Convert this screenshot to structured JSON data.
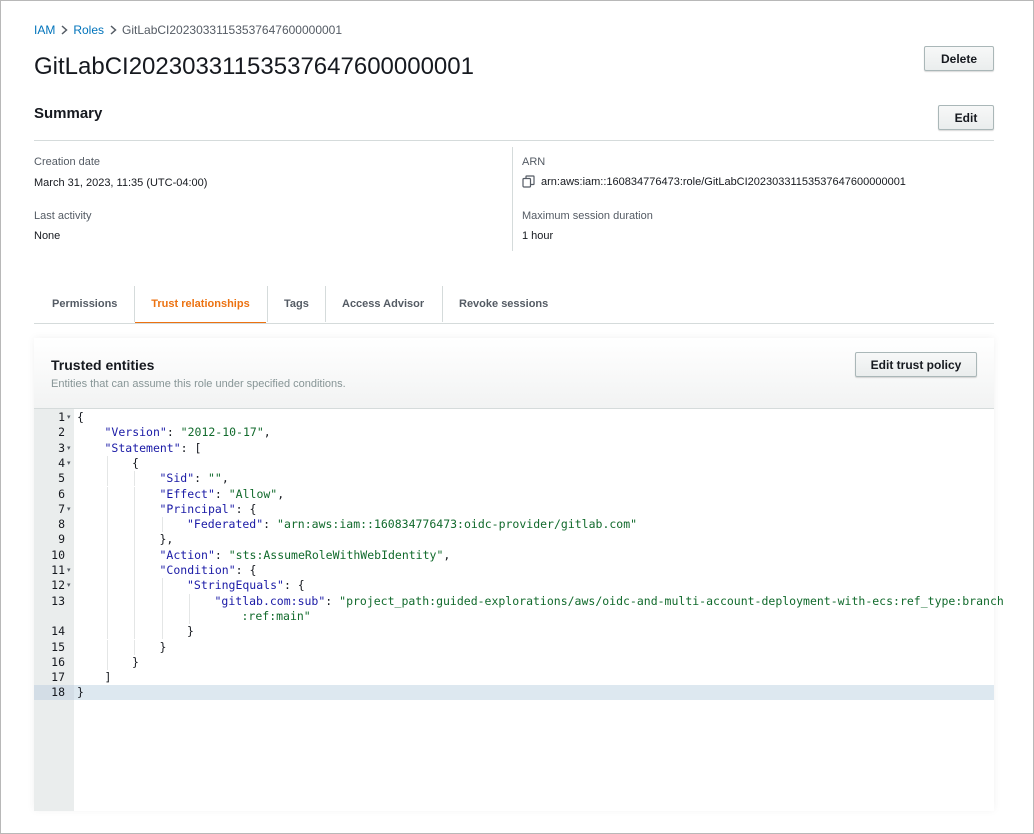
{
  "breadcrumb": {
    "items": [
      "IAM",
      "Roles",
      "GitLabCI20230331153537647600000001"
    ]
  },
  "page": {
    "title": "GitLabCI20230331153537647600000001",
    "delete_label": "Delete"
  },
  "summary": {
    "title": "Summary",
    "edit_label": "Edit",
    "creation_date_label": "Creation date",
    "creation_date_value": "March 31, 2023, 11:35 (UTC-04:00)",
    "last_activity_label": "Last activity",
    "last_activity_value": "None",
    "arn_label": "ARN",
    "arn_value": "arn:aws:iam::160834776473:role/GitLabCI20230331153537647600000001",
    "max_session_label": "Maximum session duration",
    "max_session_value": "1 hour"
  },
  "tabs": [
    {
      "label": "Permissions",
      "active": false
    },
    {
      "label": "Trust relationships",
      "active": true
    },
    {
      "label": "Tags",
      "active": false
    },
    {
      "label": "Access Advisor",
      "active": false
    },
    {
      "label": "Revoke sessions",
      "active": false
    }
  ],
  "trusted_entities": {
    "title": "Trusted entities",
    "description": "Entities that can assume this role under specified conditions.",
    "edit_label": "Edit trust policy"
  },
  "editor": {
    "lines": [
      {
        "n": "1",
        "fold": true,
        "indent": 0,
        "parts": [
          [
            "p",
            "{"
          ]
        ]
      },
      {
        "n": "2",
        "fold": false,
        "indent": 1,
        "parts": [
          [
            "k",
            "\"Version\""
          ],
          [
            "p",
            ": "
          ],
          [
            "s",
            "\"2012-10-17\""
          ],
          [
            "p",
            ","
          ]
        ]
      },
      {
        "n": "3",
        "fold": true,
        "indent": 1,
        "parts": [
          [
            "k",
            "\"Statement\""
          ],
          [
            "p",
            ": ["
          ]
        ]
      },
      {
        "n": "4",
        "fold": true,
        "indent": 2,
        "parts": [
          [
            "p",
            "{"
          ]
        ]
      },
      {
        "n": "5",
        "fold": false,
        "indent": 3,
        "parts": [
          [
            "k",
            "\"Sid\""
          ],
          [
            "p",
            ": "
          ],
          [
            "s",
            "\"\""
          ],
          [
            "p",
            ","
          ]
        ]
      },
      {
        "n": "6",
        "fold": false,
        "indent": 3,
        "parts": [
          [
            "k",
            "\"Effect\""
          ],
          [
            "p",
            ": "
          ],
          [
            "s",
            "\"Allow\""
          ],
          [
            "p",
            ","
          ]
        ]
      },
      {
        "n": "7",
        "fold": true,
        "indent": 3,
        "parts": [
          [
            "k",
            "\"Principal\""
          ],
          [
            "p",
            ": {"
          ]
        ]
      },
      {
        "n": "8",
        "fold": false,
        "indent": 4,
        "parts": [
          [
            "k",
            "\"Federated\""
          ],
          [
            "p",
            ": "
          ],
          [
            "s",
            "\"arn:aws:iam::160834776473:oidc-provider/gitlab.com\""
          ]
        ]
      },
      {
        "n": "9",
        "fold": false,
        "indent": 3,
        "parts": [
          [
            "p",
            "},"
          ]
        ]
      },
      {
        "n": "10",
        "fold": false,
        "indent": 3,
        "parts": [
          [
            "k",
            "\"Action\""
          ],
          [
            "p",
            ": "
          ],
          [
            "s",
            "\"sts:AssumeRoleWithWebIdentity\""
          ],
          [
            "p",
            ","
          ]
        ]
      },
      {
        "n": "11",
        "fold": true,
        "indent": 3,
        "parts": [
          [
            "k",
            "\"Condition\""
          ],
          [
            "p",
            ": {"
          ]
        ]
      },
      {
        "n": "12",
        "fold": true,
        "indent": 4,
        "parts": [
          [
            "k",
            "\"StringEquals\""
          ],
          [
            "p",
            ": {"
          ]
        ]
      },
      {
        "n": "13",
        "fold": false,
        "indent": 5,
        "parts": [
          [
            "k",
            "\"gitlab.com:sub\""
          ],
          [
            "p",
            ": "
          ],
          [
            "s",
            "\"project_path:guided-explorations/aws/oidc-and-multi-account-deployment-with-ecs:ref_type:branch"
          ]
        ]
      },
      {
        "n": "",
        "fold": false,
        "indent": 5,
        "wrap": true,
        "parts": [
          [
            "s",
            ":ref:main\""
          ]
        ]
      },
      {
        "n": "14",
        "fold": false,
        "indent": 4,
        "parts": [
          [
            "p",
            "}"
          ]
        ]
      },
      {
        "n": "15",
        "fold": false,
        "indent": 3,
        "parts": [
          [
            "p",
            "}"
          ]
        ]
      },
      {
        "n": "16",
        "fold": false,
        "indent": 2,
        "parts": [
          [
            "p",
            "}"
          ]
        ]
      },
      {
        "n": "17",
        "fold": false,
        "indent": 1,
        "parts": [
          [
            "p",
            "]"
          ]
        ]
      },
      {
        "n": "18",
        "fold": false,
        "indent": 0,
        "parts": [
          [
            "p",
            "}"
          ]
        ]
      }
    ]
  }
}
